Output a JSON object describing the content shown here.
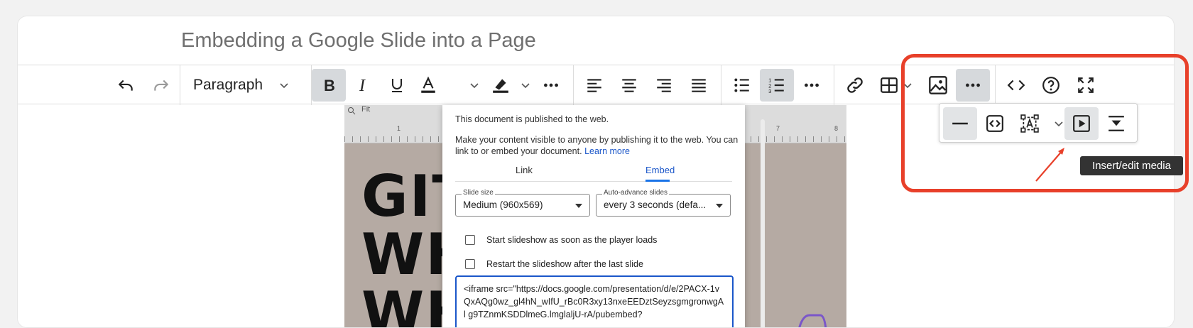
{
  "page": {
    "title": "Embedding a Google Slide into a Page"
  },
  "toolbar": {
    "paragraph_label": "Paragraph",
    "icons": [
      "undo-icon",
      "redo-icon",
      "bold-icon",
      "italic-icon",
      "underline-icon",
      "text-color-icon",
      "highlight-icon",
      "more-icon",
      "align-left-icon",
      "align-center-icon",
      "align-right-icon",
      "justify-icon",
      "bullet-list-icon",
      "numbered-list-icon",
      "more-icon",
      "link-icon",
      "table-icon",
      "image-icon",
      "more-icon",
      "source-code-icon",
      "help-icon",
      "fullscreen-icon"
    ]
  },
  "slide": {
    "ruler_zoom": "Fit",
    "ruler_marks": [
      "1",
      "7",
      "8"
    ],
    "big_text": [
      "GIT",
      "WH",
      "WH"
    ]
  },
  "dialog": {
    "published_text": "This document is published to the web.",
    "description": "Make your content visible to anyone by publishing it to the web. You can link to or embed your document.",
    "learn_more": "Learn more",
    "tabs": [
      {
        "label": "Link",
        "active": false
      },
      {
        "label": "Embed",
        "active": true
      }
    ],
    "slide_size": {
      "label": "Slide size",
      "value": "Medium (960x569)"
    },
    "auto_advance": {
      "label": "Auto-advance slides",
      "value": "every 3 seconds (defa..."
    },
    "checkbox_start": "Start slideshow as soon as the player loads",
    "checkbox_restart": "Restart the slideshow after the last slide",
    "embed_code": "<iframe src=\"https://docs.google.com/presentation/d/e/2PACX-1vQxAQg0wz_gl4hN_wIfU_rBc0R3xy13nxeEEDztSeyzsgmgronwgAl g9TZnmKSDDlmeG.lmglaljU-rA/pubembed?"
  },
  "popup": {
    "icons": [
      "horizontal-rule-icon",
      "embed-code-icon",
      "text-box-icon",
      "media-icon",
      "page-break-icon"
    ]
  },
  "tooltip": "Insert/edit media",
  "colors": {
    "highlight": "#e8402a",
    "accent": "#1a73e8",
    "active_bg": "#d6d9dc"
  }
}
